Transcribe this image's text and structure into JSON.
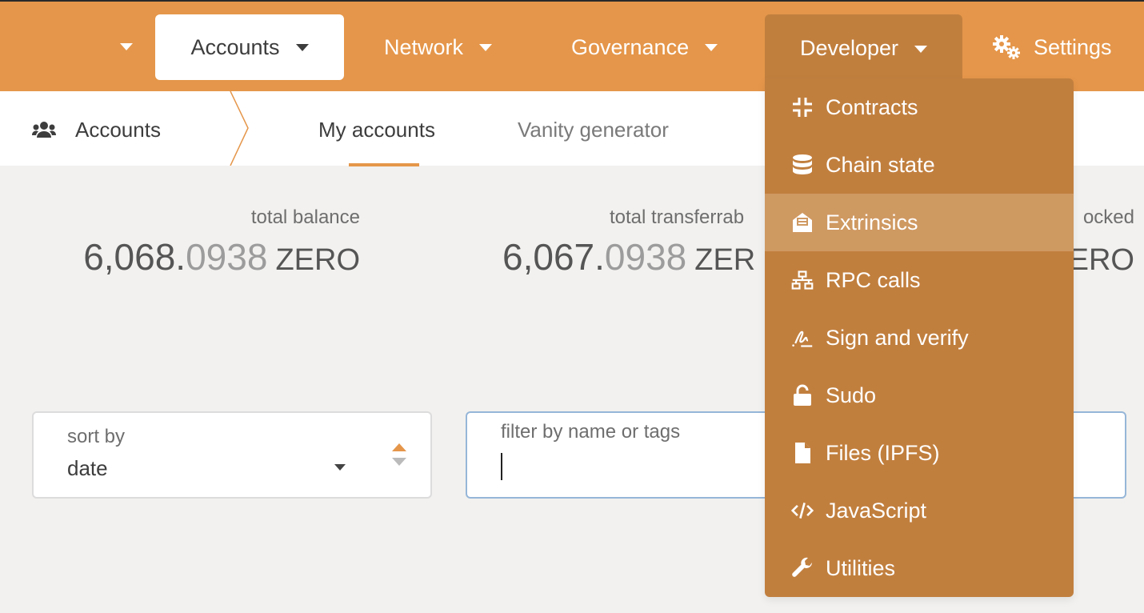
{
  "nav": {
    "items": [
      {
        "label": "Accounts"
      },
      {
        "label": "Network"
      },
      {
        "label": "Governance"
      },
      {
        "label": "Developer"
      },
      {
        "label": "Settings"
      }
    ]
  },
  "section": {
    "title": "Accounts",
    "tabs": [
      {
        "label": "My accounts"
      },
      {
        "label": "Vanity generator"
      }
    ]
  },
  "balances": [
    {
      "label": "total balance",
      "int": "6,068.",
      "dec": "0938",
      "unit": "ZERO"
    },
    {
      "label": "total transferrab",
      "int": "6,067.",
      "dec": "0938",
      "unit": "ZER"
    },
    {
      "label": "ocked",
      "unit": "ERO"
    }
  ],
  "sort": {
    "label": "sort by",
    "value": "date"
  },
  "filter": {
    "label": "filter by name or tags",
    "value": ""
  },
  "developer_menu": {
    "items": [
      {
        "label": "Contracts",
        "icon": "compress-icon"
      },
      {
        "label": "Chain state",
        "icon": "database-icon"
      },
      {
        "label": "Extrinsics",
        "icon": "envelope-open-text-icon",
        "active": true
      },
      {
        "label": "RPC calls",
        "icon": "network-wired-icon"
      },
      {
        "label": "Sign and verify",
        "icon": "signature-icon"
      },
      {
        "label": "Sudo",
        "icon": "lock-open-icon"
      },
      {
        "label": "Files (IPFS)",
        "icon": "file-icon"
      },
      {
        "label": "JavaScript",
        "icon": "code-icon"
      },
      {
        "label": "Utilities",
        "icon": "wrench-icon"
      }
    ]
  },
  "colors": {
    "brand": "#e5964a",
    "dropdown": "#c17f3e",
    "dropdown_active": "#cf9962"
  }
}
